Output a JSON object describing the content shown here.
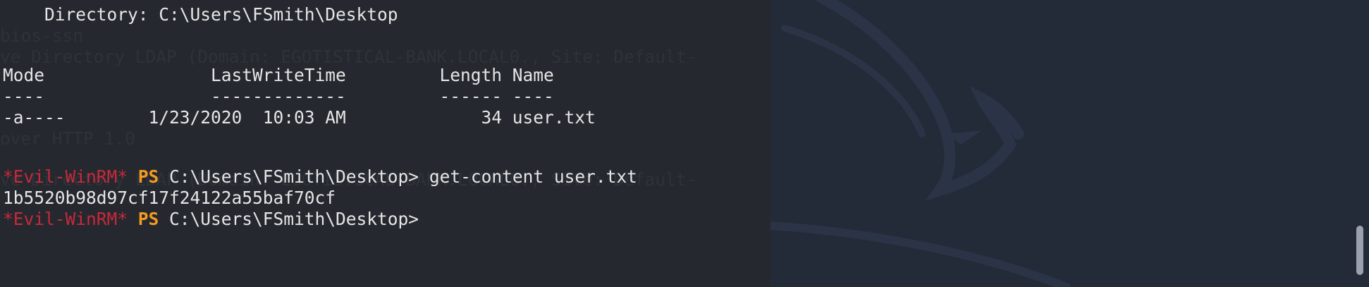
{
  "terminal": {
    "directory_line": "    Directory: C:\\Users\\FSmith\\Desktop",
    "table": {
      "header": "Mode                LastWriteTime         Length Name",
      "separator": "----                -------------         ------ ----",
      "rows": [
        "-a----        1/23/2020  10:03 AM             34 user.txt"
      ]
    },
    "commands": [
      {
        "prompt_tag": "*Evil-WinRM*",
        "ps": "PS",
        "path": " C:\\Users\\FSmith\\Desktop>",
        "command": " get-content user.txt",
        "output": "1b5520b98d97cf17f24122a55baf70cf"
      },
      {
        "prompt_tag": "*Evil-WinRM*",
        "ps": "PS",
        "path": " C:\\Users\\FSmith\\Desktop>",
        "command": ""
      }
    ]
  },
  "background_ghost_lines": [
    "bios-ssn",
    "ve Directory LDAP (Domain: EGOTISTICAL-BANK.LOCAL0., Site: Default-",
    "over HTTP 1.0",
    "ve Directory LDAP (Domain: EGOTISTICAL-BANK.LOCAL0., Site: Default-"
  ],
  "colors": {
    "background": "#25282f",
    "right_panel": "#232a38",
    "prompt_red": "#c8293a",
    "ps_orange": "#f39b22",
    "text": "#e6e6e6"
  },
  "icons": {
    "wallpaper": "kali-dragon-icon"
  }
}
